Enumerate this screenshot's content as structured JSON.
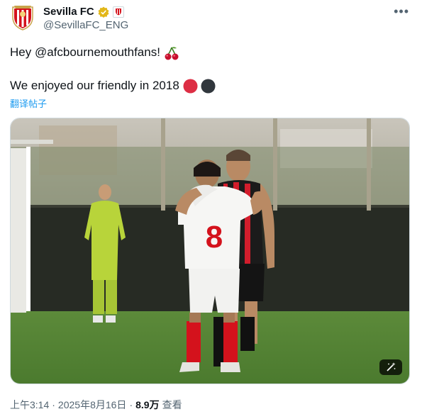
{
  "author": {
    "display_name": "Sevilla FC",
    "handle": "@SevillaFC_ENG",
    "avatar_icon": "sevilla-crest-icon",
    "verified_icon": "gold-verified-badge-icon",
    "affiliate_icon": "sevilla-affiliate-badge-icon"
  },
  "tweet": {
    "line1": "Hey @afcbournemouthfans!",
    "line2": "We enjoyed our friendly in 2018",
    "emoji1_icon": "cherries-icon",
    "emoji2_icon": "red-circle-icon",
    "emoji3_icon": "black-circle-icon",
    "translate_label": "翻译帖子"
  },
  "media": {
    "jersey_number": "8",
    "alt_icon": "magic-wand-icon"
  },
  "footer": {
    "time": "上午3:14",
    "sep1": "·",
    "date": "2025年8月16日",
    "sep2": "·",
    "views_count": "8.9万",
    "views_label": "查看"
  },
  "colors": {
    "accent": "#1d9bf0",
    "sevilla_red": "#d4121c",
    "verified_gold": "#e2b719"
  }
}
